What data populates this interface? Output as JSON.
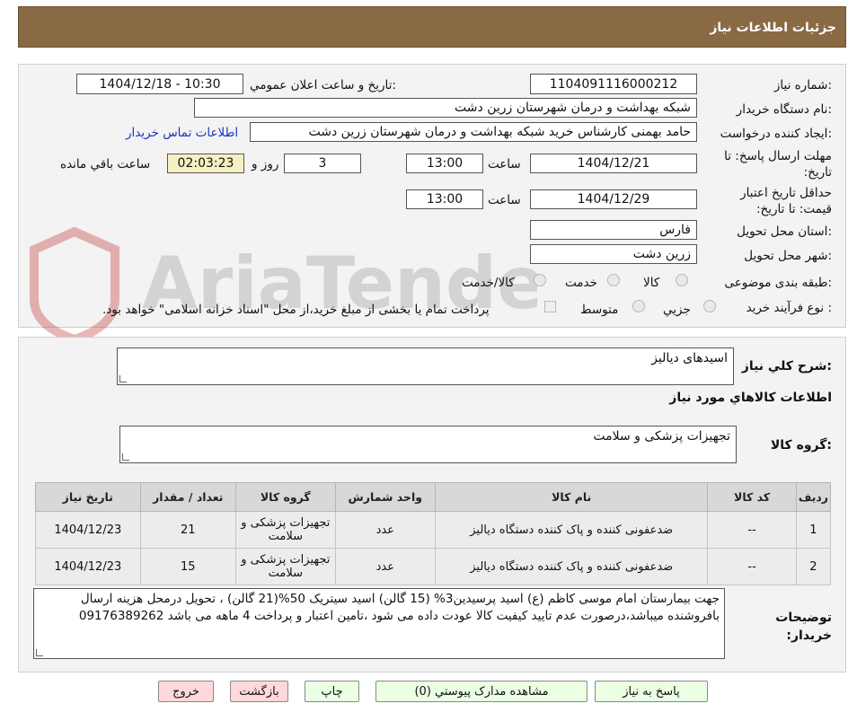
{
  "header": {
    "title": "جزئیات اطلاعات نیاز"
  },
  "form": {
    "need_number_label": "شماره نیاز:",
    "need_number": "1104091116000212",
    "announce_label": "تاریخ و ساعت اعلان عمومي:",
    "announce_value": "1404/12/18 - 10:30",
    "buyer_org_label": "نام دستگاه خريدار:",
    "buyer_org": "شبکه بهداشت و درمان شهرستان زرين دشت",
    "requester_label": "ايجاد کننده درخواست:",
    "requester": "حامد بهمنی کارشناس خرید شبکه بهداشت و درمان شهرستان زرين دشت",
    "contact_link": "اطلاعات تماس خريدار",
    "deadline_label": "مهلت ارسال پاسخ: تا تاريخ:",
    "deadline_date": "1404/12/21",
    "time_label": "ساعت",
    "deadline_time": "13:00",
    "days_value": "3",
    "days_label": "روز و",
    "remaining_time": "02:03:23",
    "remaining_label": "ساعت باقي مانده",
    "validity_label": "حداقل تاريخ اعتبار قيمت: تا تاريخ:",
    "validity_date": "1404/12/29",
    "validity_time_label": "ساعت",
    "validity_time": "13:00",
    "province_label": "استان محل تحويل:",
    "province": "فارس",
    "city_label": "شهر محل تحويل:",
    "city": "زرين دشت",
    "category_label": "طبقه بندی موضوعی:",
    "category_options": [
      "کالا",
      "خدمت",
      "کالا/خدمت"
    ],
    "process_label": "نوع فرآيند خريد :",
    "process_options": [
      "جزيي",
      "متوسط"
    ],
    "payment_note": "پرداخت تمام يا بخشی از مبلغ خريد،از محل \"اسناد خزانه اسلامی\" خواهد بود."
  },
  "details": {
    "description_label": "شرح کلي نياز:",
    "description": "اسیدهای دیالیز",
    "goods_info_title": "اطلاعات کالاهاي مورد نياز",
    "goods_group_label": "گروه کالا:",
    "goods_group": "تجهيزات پزشکی و سلامت"
  },
  "table": {
    "headers": [
      "رديف",
      "کد کالا",
      "نام کالا",
      "واحد شمارش",
      "گروه کالا",
      "تعداد / مقدار",
      "تاريخ نياز"
    ],
    "rows": [
      [
        "1",
        "--",
        "ضدعفونی کننده و پاک کننده دستگاه دیالیز",
        "عدد",
        "تجهيزات پزشکی و سلامت",
        "21",
        "1404/12/23"
      ],
      [
        "2",
        "--",
        "ضدعفونی کننده و پاک کننده دستگاه دیالیز",
        "عدد",
        "تجهيزات پزشکی و سلامت",
        "15",
        "1404/12/23"
      ]
    ]
  },
  "buyer_notes": {
    "label": "توضيحات خريدار:",
    "text": "جهت بیمارستان امام موسی کاظم (ع) اسید پرسیدین3% (15 گالن) اسید سیتریک 50%(21 گالن) ، تحویل درمحل هزینه ارسال بافروشنده میباشد،درصورت عدم تایید کیفیت کالا عودت داده می شود ،تامین اعتبار و پرداخت 4 ماهه می باشد 09176389262"
  },
  "buttons": {
    "reply": "پاسخ به نياز",
    "attachments": "مشاهده مدارک پيوستي (0)",
    "print": "چاپ",
    "back": "بازگشت",
    "exit": "خروج"
  },
  "watermark": {
    "text": "AriaTender.net"
  },
  "colors": {
    "header_bg": "#8a6a45",
    "link": "#1a33c4",
    "button_bg": "#eaffe3",
    "exit_bg": "#ffd9d9",
    "remaining_bg": "#f6f0c2"
  }
}
